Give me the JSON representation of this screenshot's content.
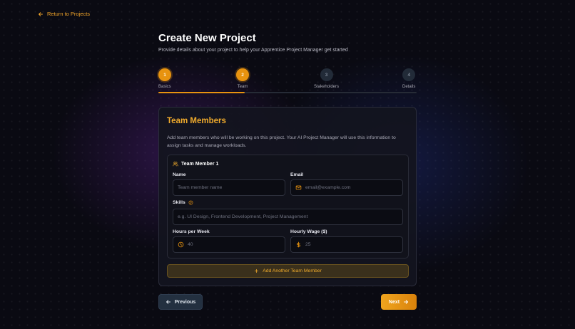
{
  "nav": {
    "return_label": "Return to Projects"
  },
  "header": {
    "title": "Create New Project",
    "subtitle": "Provide details about your project to help your Apprentice Project Manager get started"
  },
  "stepper": {
    "progress": 0.333,
    "steps": [
      {
        "number": "1",
        "label": "Basics",
        "state": "completed"
      },
      {
        "number": "2",
        "label": "Team",
        "state": "current"
      },
      {
        "number": "3",
        "label": "Stakeholders",
        "state": "upcoming"
      },
      {
        "number": "4",
        "label": "Details",
        "state": "upcoming"
      }
    ]
  },
  "card": {
    "title": "Team Members",
    "description": "Add team members who will be working on this project. Your AI Project Manager will use this information to assign tasks and manage workloads.",
    "member": {
      "heading": "Team Member 1",
      "name_label": "Name",
      "name_placeholder": "Team member name",
      "email_label": "Email",
      "email_placeholder": "email@example.com",
      "skills_label": "Skills",
      "skills_placeholder": "e.g. UI Design, Frontend Development, Project Management",
      "hours_label": "Hours per Week",
      "hours_placeholder": "40",
      "wage_label": "Hourly Wage ($)",
      "wage_placeholder": "25"
    },
    "add_member_label": "Add Another Team Member"
  },
  "footer": {
    "previous_label": "Previous",
    "next_label": "Next"
  },
  "colors": {
    "accent": "#e8930f",
    "accent_text": "#f0ab2c",
    "background": "#0a0a12"
  },
  "icons": {
    "return": "arrow-left-icon",
    "member": "users-icon",
    "email": "mail-icon",
    "skills_help": "help-circle-icon",
    "hours": "clock-icon",
    "wage": "dollar-icon",
    "add": "plus-icon",
    "previous": "arrow-left-icon",
    "next": "arrow-right-icon"
  }
}
